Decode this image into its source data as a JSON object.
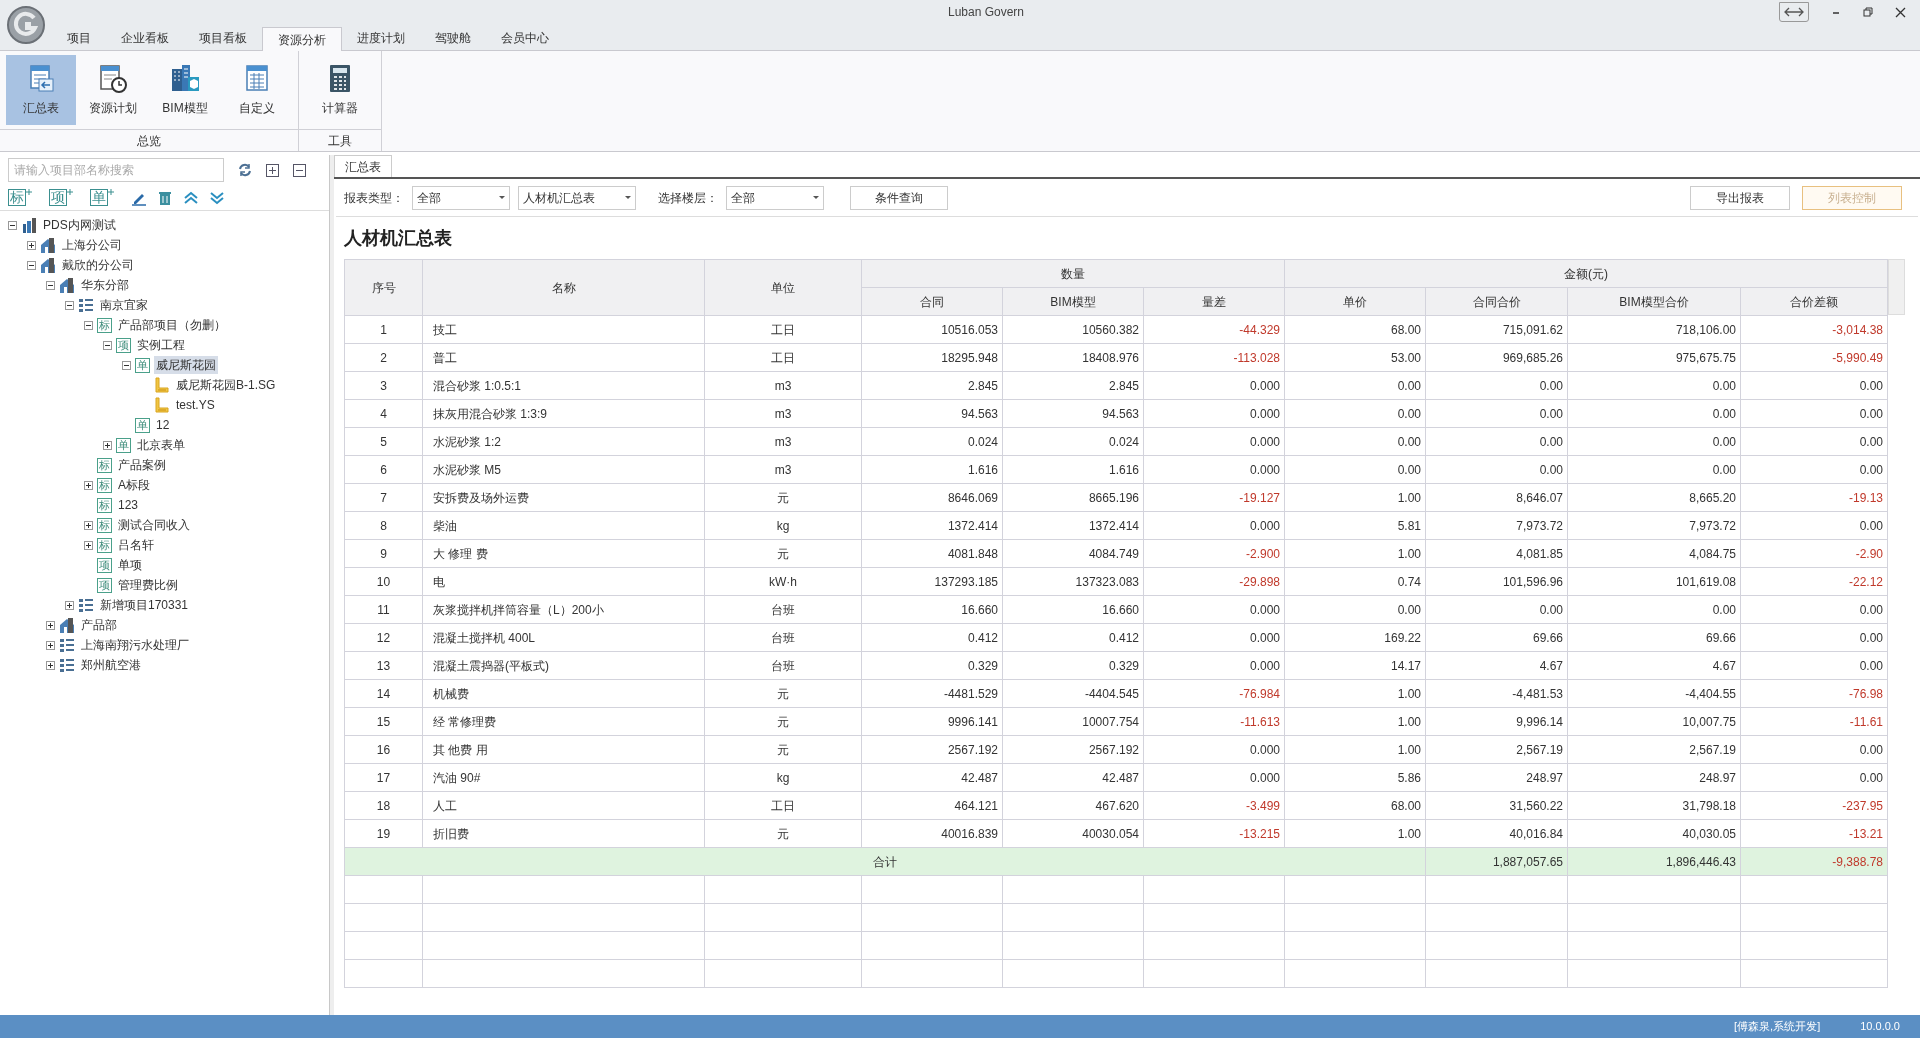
{
  "window": {
    "title": "Luban Govern"
  },
  "menu_tabs": [
    {
      "label": "项目",
      "selected": false
    },
    {
      "label": "企业看板",
      "selected": false
    },
    {
      "label": "项目看板",
      "selected": false
    },
    {
      "label": "资源分析",
      "selected": true
    },
    {
      "label": "进度计划",
      "selected": false
    },
    {
      "label": "驾驶舱",
      "selected": false
    },
    {
      "label": "会员中心",
      "selected": false
    }
  ],
  "ribbon_groups": [
    {
      "label": "总览",
      "buttons": [
        {
          "kind": "summary",
          "label": "汇总表",
          "selected": true
        },
        {
          "kind": "plan",
          "label": "资源计划",
          "selected": false
        },
        {
          "kind": "bim",
          "label": "BIM模型",
          "selected": false
        },
        {
          "kind": "custom",
          "label": "自定义",
          "selected": false
        }
      ]
    },
    {
      "label": "工具",
      "buttons": [
        {
          "kind": "calculator",
          "label": "计算器",
          "selected": false
        }
      ]
    }
  ],
  "sidebar": {
    "search": {
      "placeholder": "请输入项目部名称搜索"
    },
    "toolbar": [
      {
        "kind": "add",
        "label": "标"
      },
      {
        "kind": "add",
        "label": "项"
      },
      {
        "kind": "add",
        "label": "单"
      },
      {
        "kind": "edit"
      },
      {
        "kind": "delete"
      },
      {
        "kind": "up"
      },
      {
        "kind": "down"
      }
    ],
    "tree": [
      {
        "label": "PDS内网测试",
        "kind": "root",
        "expanded": true,
        "selected": false,
        "children": [
          {
            "label": "上海分公司",
            "kind": "branch",
            "expanded": false,
            "selected": false
          },
          {
            "label": "戴欣的分公司",
            "kind": "branch",
            "expanded": true,
            "selected": false,
            "children": [
              {
                "label": "华东分部",
                "kind": "branch",
                "expanded": true,
                "selected": false,
                "children": [
                  {
                    "label": "南京宜家",
                    "kind": "group",
                    "expanded": true,
                    "selected": false,
                    "children": [
                      {
                        "label": "产品部项目（勿删）",
                        "kind": "tag",
                        "badge": "标",
                        "expanded": true,
                        "selected": false,
                        "children": [
                          {
                            "label": "实例工程",
                            "kind": "tag",
                            "badge": "项",
                            "expanded": true,
                            "selected": false,
                            "children": [
                              {
                                "label": "威尼斯花园",
                                "kind": "tag",
                                "badge": "单",
                                "expanded": true,
                                "selected": true,
                                "children": [
                                  {
                                    "label": "威尼斯花园B-1.SG",
                                    "kind": "file",
                                    "selected": false
                                  },
                                  {
                                    "label": "test.YS",
                                    "kind": "file",
                                    "selected": false
                                  }
                                ]
                              },
                              {
                                "label": "12",
                                "kind": "tag",
                                "badge": "单",
                                "selected": false
                              }
                            ]
                          },
                          {
                            "label": "北京表单",
                            "kind": "tag",
                            "badge": "单",
                            "expanded": false,
                            "selected": false
                          }
                        ]
                      },
                      {
                        "label": "产品案例",
                        "kind": "tag",
                        "badge": "标",
                        "selected": false
                      },
                      {
                        "label": "A标段",
                        "kind": "tag",
                        "badge": "标",
                        "expanded": false,
                        "selected": false
                      },
                      {
                        "label": "123",
                        "kind": "tag",
                        "badge": "标",
                        "selected": false
                      },
                      {
                        "label": "测试合同收入",
                        "kind": "tag",
                        "badge": "标",
                        "expanded": false,
                        "selected": false
                      },
                      {
                        "label": "吕名轩",
                        "kind": "tag",
                        "badge": "标",
                        "expanded": false,
                        "selected": false
                      },
                      {
                        "label": "单项",
                        "kind": "tag",
                        "badge": "项",
                        "selected": false
                      },
                      {
                        "label": "管理费比例",
                        "kind": "tag",
                        "badge": "项",
                        "selected": false
                      }
                    ]
                  },
                  {
                    "label": "新增项目170331",
                    "kind": "group",
                    "expanded": false,
                    "selected": false
                  }
                ]
              },
              {
                "label": "产品部",
                "kind": "branch",
                "expanded": false,
                "selected": false
              },
              {
                "label": "上海南翔污水处理厂",
                "kind": "group",
                "expanded": false,
                "selected": false
              },
              {
                "label": "郑州航空港",
                "kind": "group",
                "expanded": false,
                "selected": false
              }
            ]
          }
        ]
      }
    ]
  },
  "doc_tab": {
    "label": "汇总表"
  },
  "filters": {
    "report_type_label": "报表类型：",
    "report_type": "全部",
    "report_name": "人材机汇总表",
    "floor_label": "选择楼层：",
    "floor": "全部",
    "query_button": "条件查询"
  },
  "actions": [
    {
      "label": "导出报表",
      "disabled": false
    },
    {
      "label": "列表控制",
      "disabled": true
    }
  ],
  "table": {
    "title": "人材机汇总表",
    "group_headers": {
      "quantity": "数量",
      "amount": "金额(元)"
    },
    "columns": [
      "序号",
      "名称",
      "单位",
      "合同",
      "BIM模型",
      "量差",
      "单价",
      "合同合价",
      "BIM模型合价",
      "合价差额"
    ],
    "rows": [
      {
        "no": "1",
        "name": "技工",
        "unit": "工日",
        "contract_qty": "10516.053",
        "bim_qty": "10560.382",
        "qty_diff": "-44.329",
        "unit_price": "68.00",
        "contract_total": "715,091.62",
        "bim_total": "718,106.00",
        "total_diff": "-3,014.38",
        "variance": true
      },
      {
        "no": "2",
        "name": "普工",
        "unit": "工日",
        "contract_qty": "18295.948",
        "bim_qty": "18408.976",
        "qty_diff": "-113.028",
        "unit_price": "53.00",
        "contract_total": "969,685.26",
        "bim_total": "975,675.75",
        "total_diff": "-5,990.49",
        "variance": true
      },
      {
        "no": "3",
        "name": "混合砂浆 1:0.5:1",
        "unit": "m3",
        "contract_qty": "2.845",
        "bim_qty": "2.845",
        "qty_diff": "0.000",
        "unit_price": "0.00",
        "contract_total": "0.00",
        "bim_total": "0.00",
        "total_diff": "0.00",
        "variance": false
      },
      {
        "no": "4",
        "name": "抹灰用混合砂浆 1:3:9",
        "unit": "m3",
        "contract_qty": "94.563",
        "bim_qty": "94.563",
        "qty_diff": "0.000",
        "unit_price": "0.00",
        "contract_total": "0.00",
        "bim_total": "0.00",
        "total_diff": "0.00",
        "variance": false
      },
      {
        "no": "5",
        "name": "水泥砂浆 1:2",
        "unit": "m3",
        "contract_qty": "0.024",
        "bim_qty": "0.024",
        "qty_diff": "0.000",
        "unit_price": "0.00",
        "contract_total": "0.00",
        "bim_total": "0.00",
        "total_diff": "0.00",
        "variance": false
      },
      {
        "no": "6",
        "name": "水泥砂浆 M5",
        "unit": "m3",
        "contract_qty": "1.616",
        "bim_qty": "1.616",
        "qty_diff": "0.000",
        "unit_price": "0.00",
        "contract_total": "0.00",
        "bim_total": "0.00",
        "total_diff": "0.00",
        "variance": false
      },
      {
        "no": "7",
        "name": "安拆费及场外运费",
        "unit": "元",
        "contract_qty": "8646.069",
        "bim_qty": "8665.196",
        "qty_diff": "-19.127",
        "unit_price": "1.00",
        "contract_total": "8,646.07",
        "bim_total": "8,665.20",
        "total_diff": "-19.13",
        "variance": true
      },
      {
        "no": "8",
        "name": "柴油",
        "unit": "kg",
        "contract_qty": "1372.414",
        "bim_qty": "1372.414",
        "qty_diff": "0.000",
        "unit_price": "5.81",
        "contract_total": "7,973.72",
        "bim_total": "7,973.72",
        "total_diff": "0.00",
        "variance": false
      },
      {
        "no": "9",
        "name": "大 修理 费",
        "unit": "元",
        "contract_qty": "4081.848",
        "bim_qty": "4084.749",
        "qty_diff": "-2.900",
        "unit_price": "1.00",
        "contract_total": "4,081.85",
        "bim_total": "4,084.75",
        "total_diff": "-2.90",
        "variance": true
      },
      {
        "no": "10",
        "name": "电",
        "unit": "kW·h",
        "contract_qty": "137293.185",
        "bim_qty": "137323.083",
        "qty_diff": "-29.898",
        "unit_price": "0.74",
        "contract_total": "101,596.96",
        "bim_total": "101,619.08",
        "total_diff": "-22.12",
        "variance": true
      },
      {
        "no": "11",
        "name": "灰浆搅拌机拌筒容量（L）200小",
        "unit": "台班",
        "contract_qty": "16.660",
        "bim_qty": "16.660",
        "qty_diff": "0.000",
        "unit_price": "0.00",
        "contract_total": "0.00",
        "bim_total": "0.00",
        "total_diff": "0.00",
        "variance": false
      },
      {
        "no": "12",
        "name": "混凝土搅拌机 400L",
        "unit": "台班",
        "contract_qty": "0.412",
        "bim_qty": "0.412",
        "qty_diff": "0.000",
        "unit_price": "169.22",
        "contract_total": "69.66",
        "bim_total": "69.66",
        "total_diff": "0.00",
        "variance": false
      },
      {
        "no": "13",
        "name": "混凝土震捣器(平板式)",
        "unit": "台班",
        "contract_qty": "0.329",
        "bim_qty": "0.329",
        "qty_diff": "0.000",
        "unit_price": "14.17",
        "contract_total": "4.67",
        "bim_total": "4.67",
        "total_diff": "0.00",
        "variance": false
      },
      {
        "no": "14",
        "name": "机械费",
        "unit": "元",
        "contract_qty": "-4481.529",
        "bim_qty": "-4404.545",
        "qty_diff": "-76.984",
        "unit_price": "1.00",
        "contract_total": "-4,481.53",
        "bim_total": "-4,404.55",
        "total_diff": "-76.98",
        "variance": true
      },
      {
        "no": "15",
        "name": "经 常修理费",
        "unit": "元",
        "contract_qty": "9996.141",
        "bim_qty": "10007.754",
        "qty_diff": "-11.613",
        "unit_price": "1.00",
        "contract_total": "9,996.14",
        "bim_total": "10,007.75",
        "total_diff": "-11.61",
        "variance": true
      },
      {
        "no": "16",
        "name": "其 他费 用",
        "unit": "元",
        "contract_qty": "2567.192",
        "bim_qty": "2567.192",
        "qty_diff": "0.000",
        "unit_price": "1.00",
        "contract_total": "2,567.19",
        "bim_total": "2,567.19",
        "total_diff": "0.00",
        "variance": false
      },
      {
        "no": "17",
        "name": "汽油 90#",
        "unit": "kg",
        "contract_qty": "42.487",
        "bim_qty": "42.487",
        "qty_diff": "0.000",
        "unit_price": "5.86",
        "contract_total": "248.97",
        "bim_total": "248.97",
        "total_diff": "0.00",
        "variance": false
      },
      {
        "no": "18",
        "name": "人工",
        "unit": "工日",
        "contract_qty": "464.121",
        "bim_qty": "467.620",
        "qty_diff": "-3.499",
        "unit_price": "68.00",
        "contract_total": "31,560.22",
        "bim_total": "31,798.18",
        "total_diff": "-237.95",
        "variance": true
      },
      {
        "no": "19",
        "name": "折旧费",
        "unit": "元",
        "contract_qty": "40016.839",
        "bim_qty": "40030.054",
        "qty_diff": "-13.215",
        "unit_price": "1.00",
        "contract_total": "40,016.84",
        "bim_total": "40,030.05",
        "total_diff": "-13.21",
        "variance": true
      }
    ],
    "total": {
      "label": "合计",
      "contract_total": "1,887,057.65",
      "bim_total": "1,896,446.43",
      "total_diff": "-9,388.78",
      "variance": true
    }
  },
  "status_bar": {
    "user": "[傅森泉,系统开发]",
    "version": "10.0.0.0"
  }
}
